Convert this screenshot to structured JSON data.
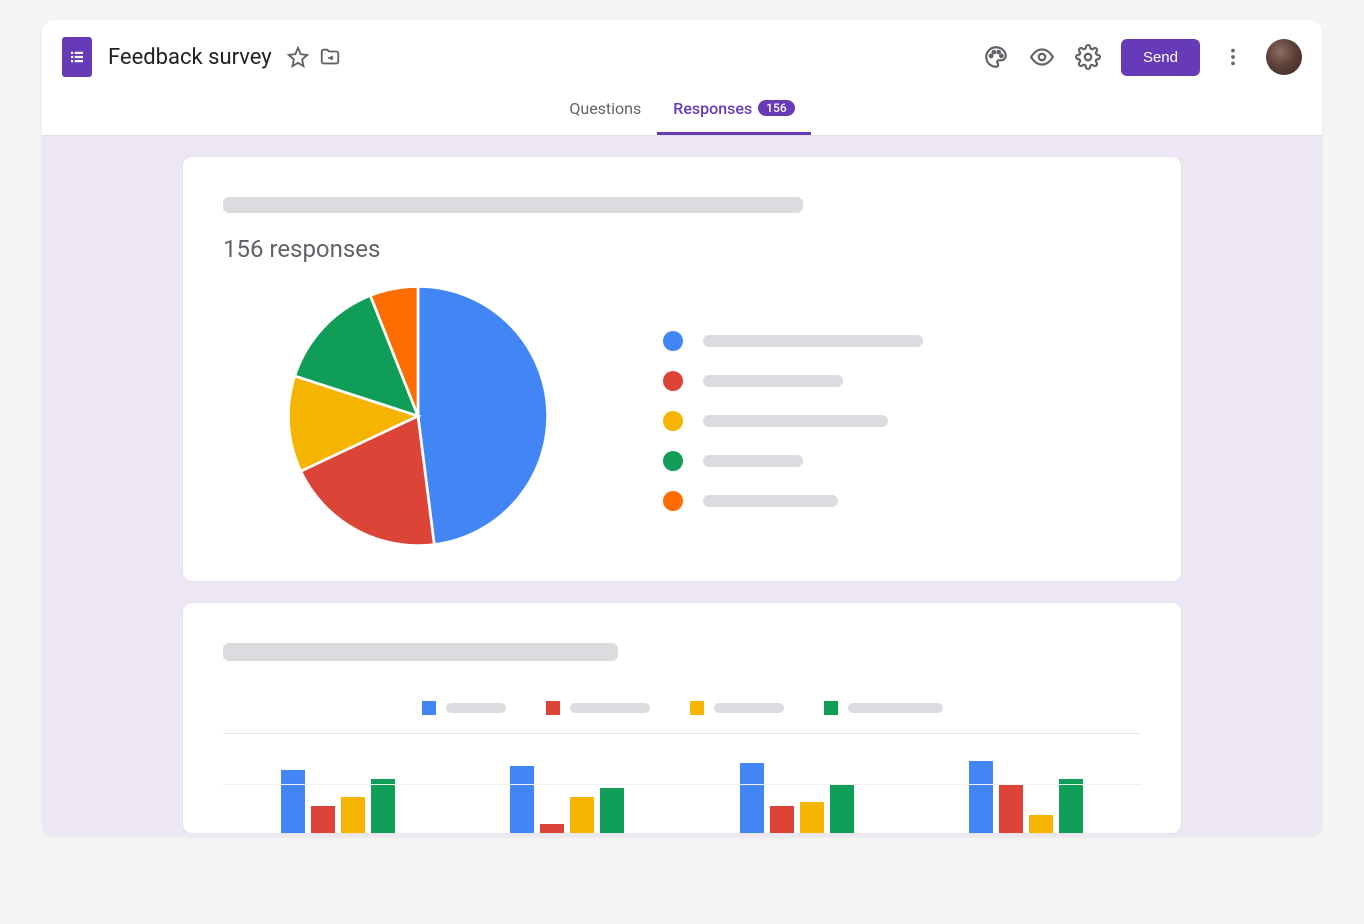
{
  "header": {
    "title": "Feedback survey",
    "send_label": "Send"
  },
  "tabs": {
    "questions": "Questions",
    "responses": "Responses",
    "badge": "156"
  },
  "summary": {
    "responses_text": "156 responses"
  },
  "colors": {
    "blue": "#4285f4",
    "red": "#db4437",
    "yellow": "#f4b400",
    "green": "#0f9d58",
    "orange": "#ff6d00"
  },
  "chart_data": [
    {
      "type": "pie",
      "title": "",
      "series_colors": [
        "#4285f4",
        "#db4437",
        "#f4b400",
        "#0f9d58",
        "#ff6d00"
      ],
      "values": [
        48,
        20,
        12,
        14,
        6
      ],
      "legend_label_widths": [
        220,
        140,
        185,
        100,
        135
      ]
    },
    {
      "type": "bar",
      "series": [
        {
          "name": "blue",
          "color": "#4285f4"
        },
        {
          "name": "red",
          "color": "#db4437"
        },
        {
          "name": "yellow",
          "color": "#f4b400"
        },
        {
          "name": "green",
          "color": "#0f9d58"
        }
      ],
      "legend_label_widths": [
        60,
        80,
        70,
        95
      ],
      "groups": [
        [
          70,
          30,
          40,
          60
        ],
        [
          75,
          10,
          40,
          50
        ],
        [
          78,
          30,
          35,
          55
        ],
        [
          80,
          55,
          20,
          60
        ]
      ],
      "y_max": 100
    }
  ]
}
